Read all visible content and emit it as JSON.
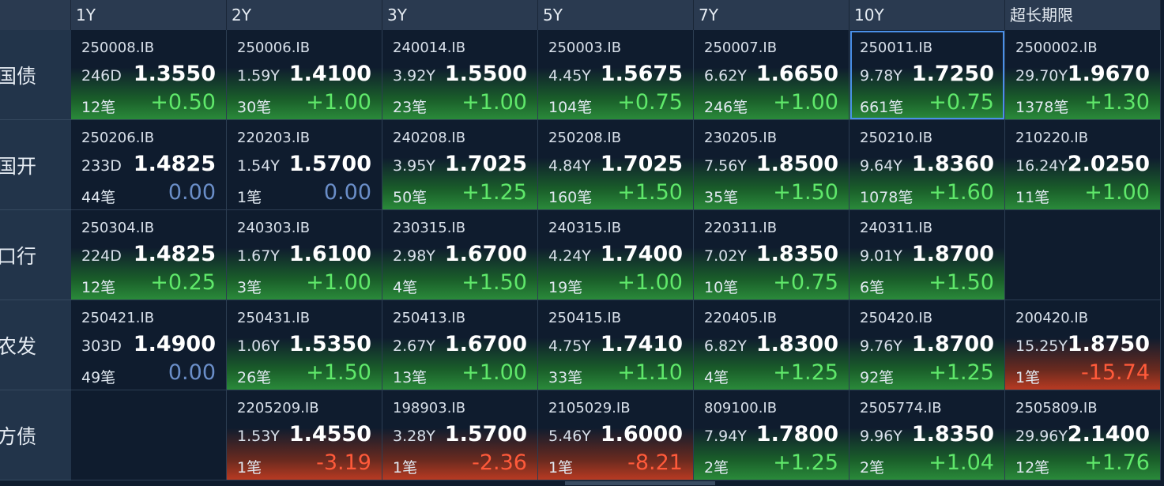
{
  "columns": [
    "1Y",
    "2Y",
    "3Y",
    "5Y",
    "7Y",
    "10Y",
    "超长期限"
  ],
  "rows": [
    {
      "label": "国债",
      "cells": [
        {
          "code": "250008.IB",
          "tenor": "246D",
          "price": "1.3550",
          "count": "12笔",
          "change": "+0.50",
          "trend": "up"
        },
        {
          "code": "250006.IB",
          "tenor": "1.59Y",
          "price": "1.4100",
          "count": "30笔",
          "change": "+1.00",
          "trend": "up"
        },
        {
          "code": "240014.IB",
          "tenor": "3.92Y",
          "price": "1.5500",
          "count": "23笔",
          "change": "+1.00",
          "trend": "up"
        },
        {
          "code": "250003.IB",
          "tenor": "4.45Y",
          "price": "1.5675",
          "count": "104笔",
          "change": "+0.75",
          "trend": "up"
        },
        {
          "code": "250007.IB",
          "tenor": "6.62Y",
          "price": "1.6650",
          "count": "246笔",
          "change": "+1.00",
          "trend": "up"
        },
        {
          "code": "250011.IB",
          "tenor": "9.78Y",
          "price": "1.7250",
          "count": "661笔",
          "change": "+0.75",
          "trend": "up",
          "selected": true
        },
        {
          "code": "2500002.IB",
          "tenor": "29.70Y",
          "price": "1.9670",
          "count": "1378笔",
          "change": "+1.30",
          "trend": "up"
        }
      ]
    },
    {
      "label": "国开",
      "cells": [
        {
          "code": "250206.IB",
          "tenor": "233D",
          "price": "1.4825",
          "count": "44笔",
          "change": "0.00",
          "trend": "zero"
        },
        {
          "code": "220203.IB",
          "tenor": "1.54Y",
          "price": "1.5700",
          "count": "1笔",
          "change": "0.00",
          "trend": "zero"
        },
        {
          "code": "240208.IB",
          "tenor": "3.95Y",
          "price": "1.7025",
          "count": "50笔",
          "change": "+1.25",
          "trend": "up"
        },
        {
          "code": "250208.IB",
          "tenor": "4.84Y",
          "price": "1.7025",
          "count": "160笔",
          "change": "+1.50",
          "trend": "up"
        },
        {
          "code": "230205.IB",
          "tenor": "7.56Y",
          "price": "1.8500",
          "count": "35笔",
          "change": "+1.50",
          "trend": "up"
        },
        {
          "code": "250210.IB",
          "tenor": "9.64Y",
          "price": "1.8360",
          "count": "1078笔",
          "change": "+1.60",
          "trend": "up"
        },
        {
          "code": "210220.IB",
          "tenor": "16.24Y",
          "price": "2.0250",
          "count": "11笔",
          "change": "+1.00",
          "trend": "up"
        }
      ]
    },
    {
      "label": "口行",
      "cells": [
        {
          "code": "250304.IB",
          "tenor": "224D",
          "price": "1.4825",
          "count": "12笔",
          "change": "+0.25",
          "trend": "up"
        },
        {
          "code": "240303.IB",
          "tenor": "1.67Y",
          "price": "1.6100",
          "count": "3笔",
          "change": "+1.00",
          "trend": "up"
        },
        {
          "code": "230315.IB",
          "tenor": "2.98Y",
          "price": "1.6700",
          "count": "4笔",
          "change": "+1.50",
          "trend": "up"
        },
        {
          "code": "240315.IB",
          "tenor": "4.24Y",
          "price": "1.7400",
          "count": "19笔",
          "change": "+1.00",
          "trend": "up"
        },
        {
          "code": "220311.IB",
          "tenor": "7.02Y",
          "price": "1.8350",
          "count": "10笔",
          "change": "+0.75",
          "trend": "up"
        },
        {
          "code": "240311.IB",
          "tenor": "9.01Y",
          "price": "1.8700",
          "count": "6笔",
          "change": "+1.50",
          "trend": "up"
        },
        null
      ]
    },
    {
      "label": "农发",
      "cells": [
        {
          "code": "250421.IB",
          "tenor": "303D",
          "price": "1.4900",
          "count": "49笔",
          "change": "0.00",
          "trend": "zero"
        },
        {
          "code": "250431.IB",
          "tenor": "1.06Y",
          "price": "1.5350",
          "count": "26笔",
          "change": "+1.50",
          "trend": "up"
        },
        {
          "code": "250413.IB",
          "tenor": "2.67Y",
          "price": "1.6700",
          "count": "13笔",
          "change": "+1.00",
          "trend": "up"
        },
        {
          "code": "250415.IB",
          "tenor": "4.75Y",
          "price": "1.7410",
          "count": "33笔",
          "change": "+1.10",
          "trend": "up"
        },
        {
          "code": "220405.IB",
          "tenor": "6.82Y",
          "price": "1.8300",
          "count": "4笔",
          "change": "+1.25",
          "trend": "up"
        },
        {
          "code": "250420.IB",
          "tenor": "9.76Y",
          "price": "1.8700",
          "count": "92笔",
          "change": "+1.25",
          "trend": "up"
        },
        {
          "code": "200420.IB",
          "tenor": "15.25Y",
          "price": "1.8750",
          "count": "1笔",
          "change": "-15.74",
          "trend": "down"
        }
      ]
    },
    {
      "label": "地方债",
      "cells": [
        null,
        {
          "code": "2205209.IB",
          "tenor": "1.53Y",
          "price": "1.4550",
          "count": "1笔",
          "change": "-3.19",
          "trend": "down"
        },
        {
          "code": "198903.IB",
          "tenor": "3.28Y",
          "price": "1.5700",
          "count": "1笔",
          "change": "-2.36",
          "trend": "down"
        },
        {
          "code": "2105029.IB",
          "tenor": "5.46Y",
          "price": "1.6000",
          "count": "1笔",
          "change": "-8.21",
          "trend": "down"
        },
        {
          "code": "809100.IB",
          "tenor": "7.94Y",
          "price": "1.7800",
          "count": "2笔",
          "change": "+1.25",
          "trend": "up"
        },
        {
          "code": "2505774.IB",
          "tenor": "9.96Y",
          "price": "1.8350",
          "count": "2笔",
          "change": "+1.04",
          "trend": "up"
        },
        {
          "code": "2505809.IB",
          "tenor": "29.96Y",
          "price": "2.1400",
          "count": "12笔",
          "change": "+1.76",
          "trend": "up"
        }
      ]
    }
  ],
  "colors": {
    "up": "#5fe86a",
    "down": "#ff5a3a",
    "zero": "#6a8ec8",
    "selection": "#4a90e8"
  }
}
